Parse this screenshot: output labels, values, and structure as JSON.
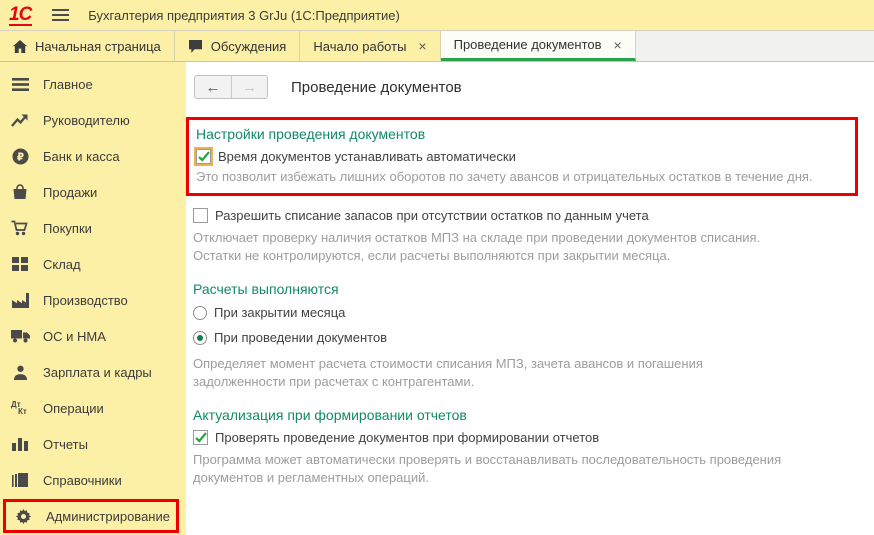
{
  "topbar": {
    "logo_text": "1С",
    "title": "Бухгалтерия предприятия 3 GrJu  (1С:Предприятие)"
  },
  "tabs": {
    "home": {
      "label": "Начальная страница"
    },
    "discussions": {
      "label": "Обсуждения"
    },
    "getting_started": {
      "label": "Начало работы",
      "close": "×"
    },
    "doc_posting": {
      "label": "Проведение документов",
      "close": "×",
      "active": true
    }
  },
  "sidebar": {
    "items": [
      {
        "label": "Главное",
        "icon": "main-menu-icon"
      },
      {
        "label": "Руководителю",
        "icon": "trend-icon"
      },
      {
        "label": "Банк и касса",
        "icon": "ruble-icon"
      },
      {
        "label": "Продажи",
        "icon": "bag-icon"
      },
      {
        "label": "Покупки",
        "icon": "cart-icon"
      },
      {
        "label": "Склад",
        "icon": "warehouse-grid-icon"
      },
      {
        "label": "Производство",
        "icon": "factory-icon"
      },
      {
        "label": "ОС и НМА",
        "icon": "truck-icon"
      },
      {
        "label": "Зарплата и кадры",
        "icon": "person-icon"
      },
      {
        "label": "Операции",
        "icon": "dtkt-icon",
        "glyph_top": "Дт",
        "glyph_bottom": "Кт"
      },
      {
        "label": "Отчеты",
        "icon": "bar-chart-icon"
      },
      {
        "label": "Справочники",
        "icon": "books-icon"
      },
      {
        "label": "Администрирование",
        "icon": "gear-icon",
        "annotated": true
      }
    ]
  },
  "content": {
    "nav": {
      "back": "←",
      "forward": "→"
    },
    "page_title": "Проведение документов",
    "posting_settings": {
      "heading": "Настройки проведения документов",
      "auto_time_label": "Время документов устанавливать автоматически",
      "auto_time_checked": true,
      "hint": "Это позволит избежать лишних оборотов по зачету авансов и отрицательных остатков в течение дня."
    },
    "allow_writeoff": {
      "label": "Разрешить списание запасов при отсутствии остатков по данным учета",
      "checked": false,
      "hint_line1": "Отключает проверку наличия остатков МПЗ на складе при проведении документов списания.",
      "hint_line2": "Остатки не контролируются, если расчеты выполняются при закрытии месяца."
    },
    "calculations": {
      "heading": "Расчеты выполняются",
      "option_month_close": {
        "label": "При закрытии месяца",
        "selected": false
      },
      "option_doc_posting": {
        "label": "При проведении документов",
        "selected": true
      },
      "hint_line1": "Определяет момент расчета стоимости списания МПЗ, зачета авансов и погашения",
      "hint_line2": "задолженности при расчетах с контрагентами."
    },
    "actualization": {
      "heading": "Актуализация при формировании отчетов",
      "check_label": "Проверять проведение документов при формировании отчетов",
      "checked": true,
      "hint_line1": "Программа может автоматически проверять и восстанавливать последовательность проведения",
      "hint_line2": "документов и регламентных операций."
    }
  },
  "glyphs": {
    "ruble": "₽"
  },
  "colors": {
    "brand_yellow": "#fcefa6",
    "accent_green": "#128a68",
    "tab_underline_green": "#2ca24c",
    "annotation_red": "#ee0000",
    "check_green": "#23a73d",
    "radio_green": "#0f7a4d",
    "logo_red": "#e30613",
    "hint_gray": "#9d9d9d"
  }
}
